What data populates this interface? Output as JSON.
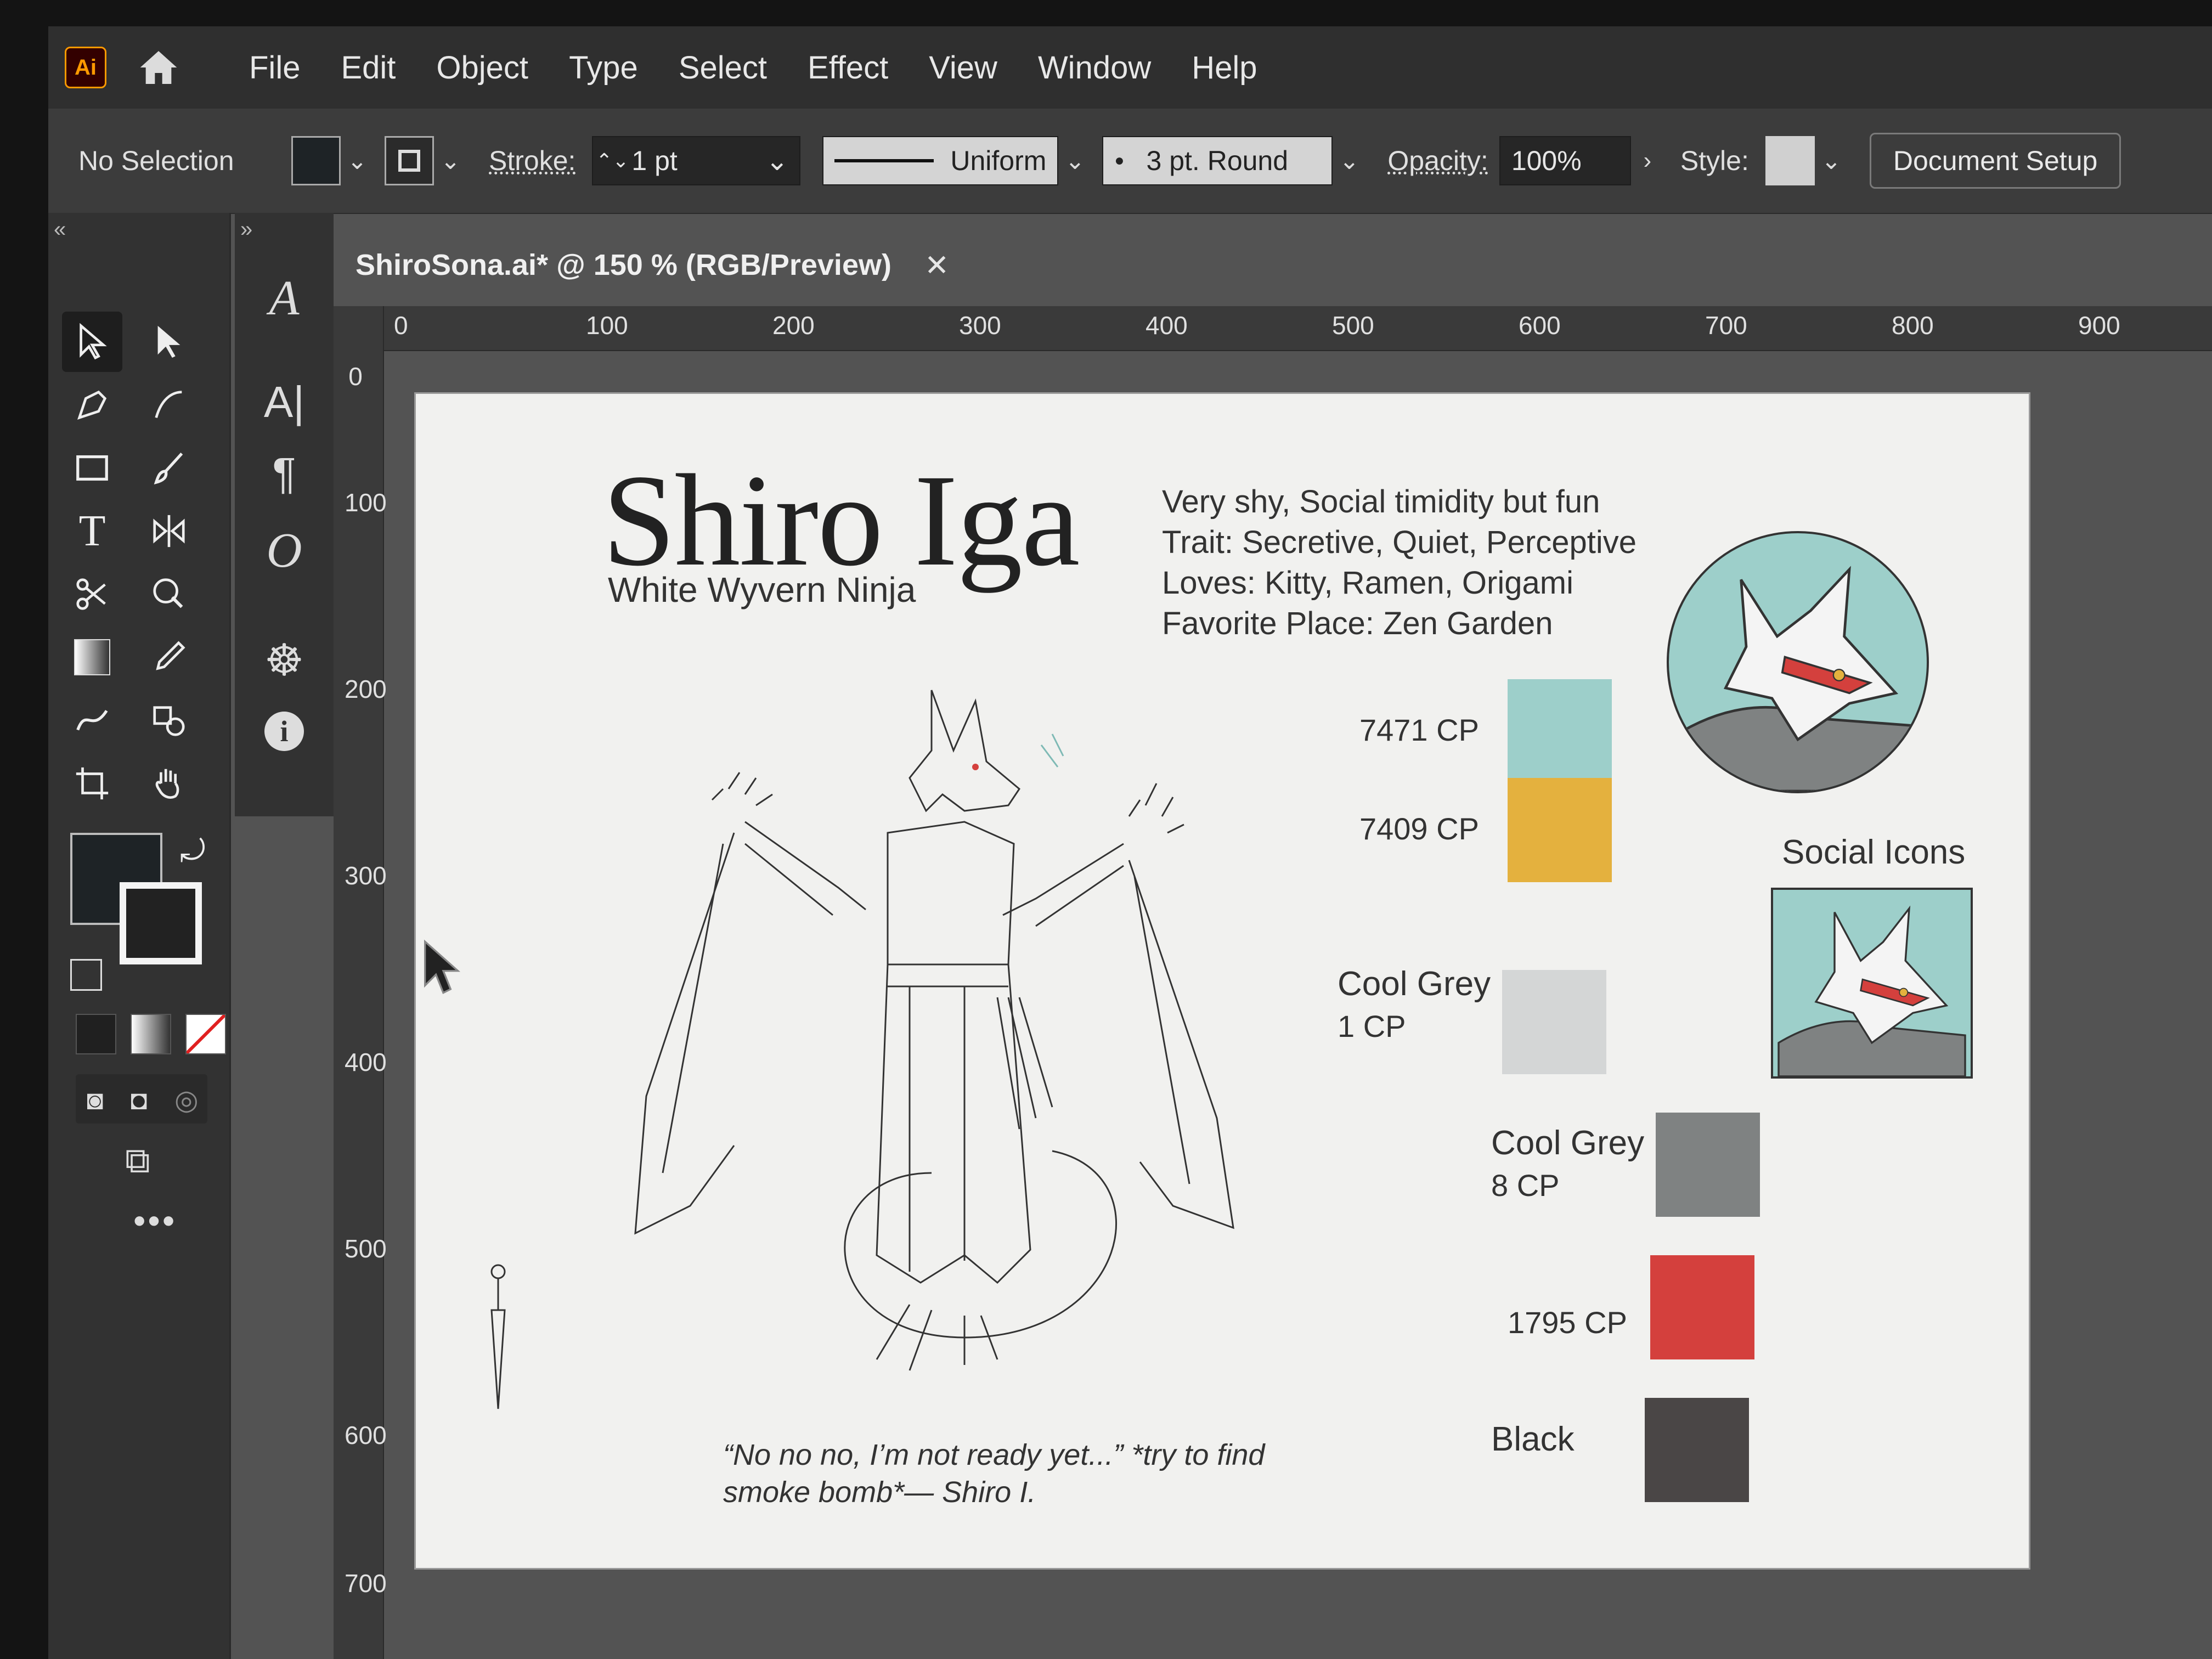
{
  "app": {
    "logo": "Ai",
    "menu": [
      "File",
      "Edit",
      "Object",
      "Type",
      "Select",
      "Effect",
      "View",
      "Window",
      "Help"
    ]
  },
  "control": {
    "selection": "No Selection",
    "stroke_label": "Stroke:",
    "stroke_value": "1 pt",
    "profile": "Uniform",
    "brush": "3 pt. Round",
    "opacity_label": "Opacity:",
    "opacity_value": "100%",
    "style_label": "Style:",
    "document_setup": "Document Setup"
  },
  "document": {
    "tab_title": "ShiroSona.ai* @ 150 % (RGB/Preview)",
    "ruler_top": [
      "0",
      "100",
      "200",
      "300",
      "400",
      "500",
      "600",
      "700",
      "800",
      "900"
    ],
    "ruler_left": [
      "0",
      "100",
      "200",
      "300",
      "400",
      "500",
      "600",
      "700"
    ]
  },
  "artboard": {
    "title": "Shiro Iga",
    "subtitle": "White Wyvern Ninja",
    "desc": [
      "Very shy, Social timidity but fun",
      "Trait: Secretive, Quiet, Perceptive",
      "Loves: Kitty, Ramen, Origami",
      "Favorite Place: Zen Garden"
    ],
    "palette": [
      {
        "label": "7471 CP",
        "color": "#9dcfca"
      },
      {
        "label": "7409 CP",
        "color": "#e4b13e"
      },
      {
        "label": "Cool Grey",
        "sub": "1 CP",
        "color": "#d4d6d6"
      },
      {
        "label": "Cool Grey",
        "sub": "8 CP",
        "color": "#7f8282"
      },
      {
        "label": "1795 CP",
        "color": "#d4403d"
      },
      {
        "label": "Black",
        "color": "#4a4646"
      }
    ],
    "social_title": "Social Icons",
    "quote_line1": "“No no no, I’m not ready yet...” *try to find",
    "quote_line2": "smoke bomb*— Shiro I."
  }
}
